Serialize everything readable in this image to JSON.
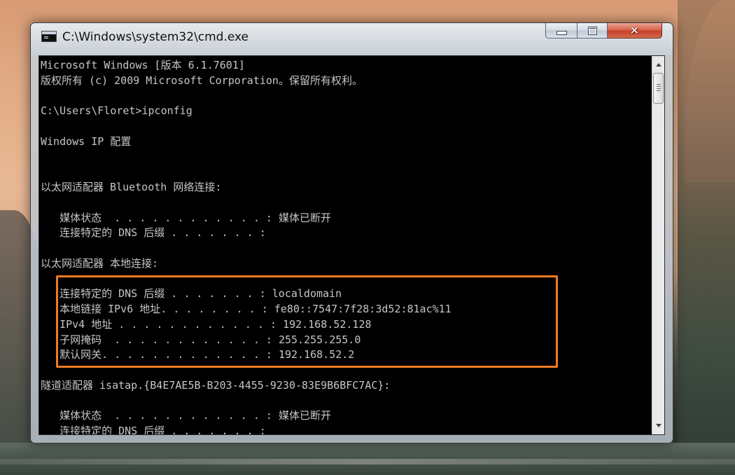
{
  "window": {
    "title": "C:\\Windows\\system32\\cmd.exe"
  },
  "console": {
    "lines": [
      "Microsoft Windows [版本 6.1.7601]",
      "版权所有 (c) 2009 Microsoft Corporation。保留所有权利。",
      "",
      "C:\\Users\\Floret>ipconfig",
      "",
      "Windows IP 配置",
      "",
      "",
      "以太网适配器 Bluetooth 网络连接:",
      "",
      "   媒体状态  . . . . . . . . . . . . : 媒体已断开",
      "   连接特定的 DNS 后缀 . . . . . . . :",
      "",
      "以太网适配器 本地连接:",
      "",
      "   连接特定的 DNS 后缀 . . . . . . . : localdomain",
      "   本地链接 IPv6 地址. . . . . . . . : fe80::7547:7f28:3d52:81ac%11",
      "   IPv4 地址 . . . . . . . . . . . . : 192.168.52.128",
      "   子网掩码  . . . . . . . . . . . . : 255.255.255.0",
      "   默认网关. . . . . . . . . . . . . : 192.168.52.2",
      "",
      "隧道适配器 isatap.{B4E7AE5B-B203-4455-9230-83E9B6BFC7AC}:",
      "",
      "   媒体状态  . . . . . . . . . . . . : 媒体已断开",
      "   连接特定的 DNS 后缀 . . . . . . . :"
    ]
  },
  "colors": {
    "console_bg": "#000000",
    "console_text": "#c6c6c6",
    "highlight_border": "#f07b22"
  }
}
